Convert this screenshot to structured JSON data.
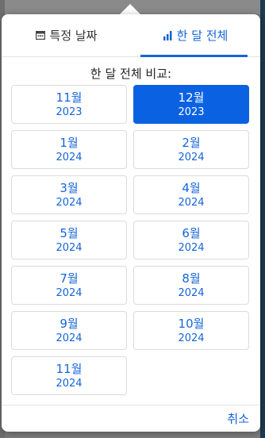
{
  "tabs": [
    {
      "label": "특정 날짜",
      "icon": "calendar-icon",
      "active": false
    },
    {
      "label": "한 달 전체",
      "icon": "bar-chart-icon",
      "active": true
    }
  ],
  "heading": "한 달 전체 비교:",
  "months": [
    {
      "month": "11월",
      "year": "2023",
      "selected": false
    },
    {
      "month": "12월",
      "year": "2023",
      "selected": true
    },
    {
      "month": "1월",
      "year": "2024",
      "selected": false
    },
    {
      "month": "2월",
      "year": "2024",
      "selected": false
    },
    {
      "month": "3월",
      "year": "2024",
      "selected": false
    },
    {
      "month": "4월",
      "year": "2024",
      "selected": false
    },
    {
      "month": "5월",
      "year": "2024",
      "selected": false
    },
    {
      "month": "6월",
      "year": "2024",
      "selected": false
    },
    {
      "month": "7월",
      "year": "2024",
      "selected": false
    },
    {
      "month": "8월",
      "year": "2024",
      "selected": false
    },
    {
      "month": "9월",
      "year": "2024",
      "selected": false
    },
    {
      "month": "10월",
      "year": "2024",
      "selected": false
    },
    {
      "month": "11월",
      "year": "2024",
      "selected": false
    }
  ],
  "footer": {
    "cancel_label": "취소"
  },
  "colors": {
    "accent": "#1565d8",
    "selected_bg": "#0a62e2"
  }
}
